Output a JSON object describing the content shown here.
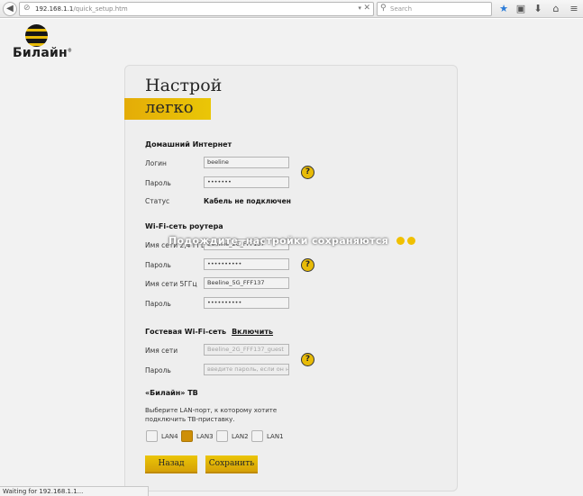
{
  "browser": {
    "url_host": "192.168.1.1",
    "url_path": "/quick_setup.htm",
    "search_placeholder": "Search",
    "status_text": "Waiting for 192.168.1.1..."
  },
  "logo": {
    "text": "Билайн",
    "mark": "®"
  },
  "header": {
    "title_line1": "Настрой",
    "title_line2": "легко"
  },
  "home_internet": {
    "heading": "Домашний Интернет",
    "login_label": "Логин",
    "login_value": "beeline",
    "password_label": "Пароль",
    "password_value": "•••••••",
    "status_label": "Статус",
    "status_value": "Кабель не подключен"
  },
  "wifi": {
    "heading": "Wi-Fi-сеть роутера",
    "ssid24_label": "Имя сети 2,4 ГГц",
    "ssid24_value": "Beeline_2G_FFF137",
    "password24_label": "Пароль",
    "password24_value": "••••••••••",
    "ssid5_label": "Имя сети 5ГГц",
    "ssid5_value": "Beeline_5G_FFF137",
    "password5_label": "Пароль",
    "password5_value": "••••••••••"
  },
  "guest": {
    "heading": "Гостевая Wi-Fi-сеть",
    "enable_link": "Включить",
    "ssid_label": "Имя сети",
    "ssid_value": "Beeline_2G_FFF137_guest",
    "password_label": "Пароль",
    "password_placeholder": "введите пароль, если он нужен"
  },
  "tv": {
    "heading": "«Билайн» ТВ",
    "description": "Выберите LAN-порт, к которому хотите подключить ТВ-приставку.",
    "ports": [
      {
        "label": "LAN4",
        "checked": false
      },
      {
        "label": "LAN3",
        "checked": true
      },
      {
        "label": "LAN2",
        "checked": false
      },
      {
        "label": "LAN1",
        "checked": false
      }
    ]
  },
  "buttons": {
    "back": "Назад",
    "save": "Сохранить"
  },
  "help_glyph": "?",
  "overlay": {
    "message": "Подождите, настройки сохраняются"
  },
  "colors": {
    "brand_yellow": "#f5c400",
    "button_yellow": "#f0bc00",
    "checked": "#d89400"
  }
}
